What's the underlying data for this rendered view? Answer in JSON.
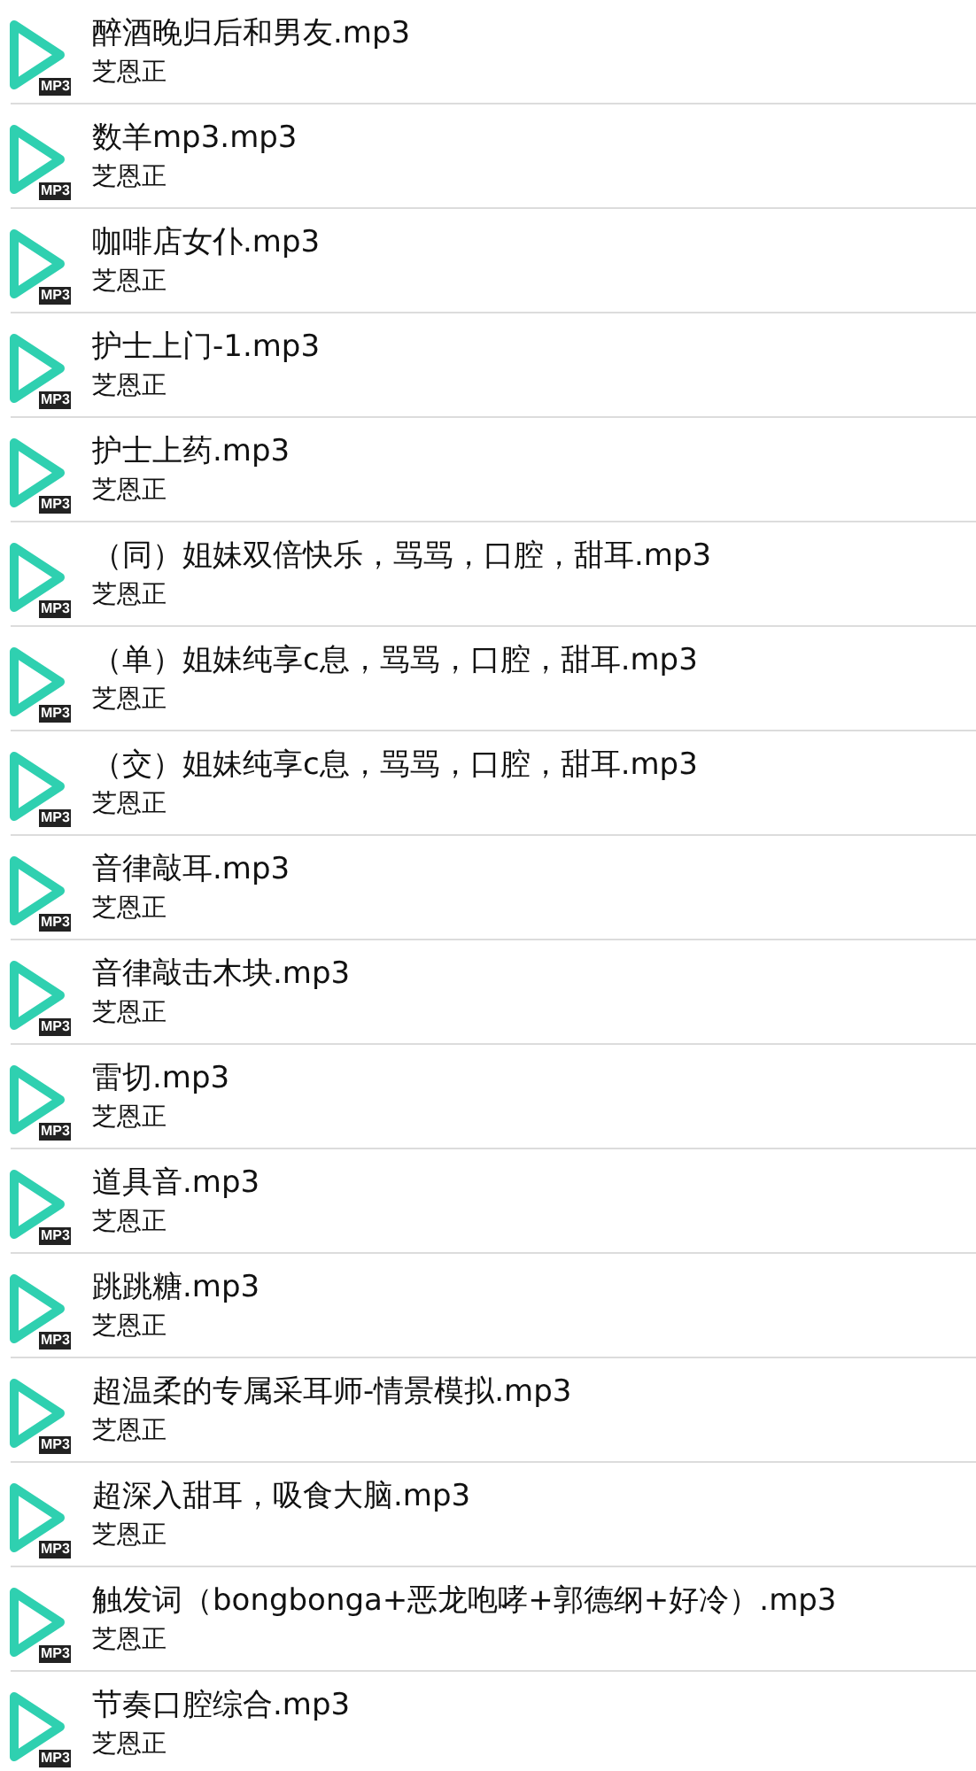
{
  "tracks": [
    {
      "title": "醉酒晚归后和男友.mp3",
      "artist": "芝恩正",
      "badge": "MP3"
    },
    {
      "title": "数羊mp3.mp3",
      "artist": "芝恩正",
      "badge": "MP3"
    },
    {
      "title": "咖啡店女仆.mp3",
      "artist": "芝恩正",
      "badge": "MP3"
    },
    {
      "title": "护士上门-1.mp3",
      "artist": "芝恩正",
      "badge": "MP3"
    },
    {
      "title": "护士上药.mp3",
      "artist": "芝恩正",
      "badge": "MP3"
    },
    {
      "title": "（同）姐妹双倍快乐，骂骂，口腔，甜耳.mp3",
      "artist": "芝恩正",
      "badge": "MP3"
    },
    {
      "title": "（单）姐妹纯享c息，骂骂，口腔，甜耳.mp3",
      "artist": "芝恩正",
      "badge": "MP3"
    },
    {
      "title": "（交）姐妹纯享c息，骂骂，口腔，甜耳.mp3",
      "artist": "芝恩正",
      "badge": "MP3"
    },
    {
      "title": "音律敲耳.mp3",
      "artist": "芝恩正",
      "badge": "MP3"
    },
    {
      "title": "音律敲击木块.mp3",
      "artist": "芝恩正",
      "badge": "MP3"
    },
    {
      "title": "雷切.mp3",
      "artist": "芝恩正",
      "badge": "MP3"
    },
    {
      "title": "道具音.mp3",
      "artist": "芝恩正",
      "badge": "MP3"
    },
    {
      "title": "跳跳糖.mp3",
      "artist": "芝恩正",
      "badge": "MP3"
    },
    {
      "title": "超温柔的专属采耳师-情景模拟.mp3",
      "artist": "芝恩正",
      "badge": "MP3"
    },
    {
      "title": "超深入甜耳，吸食大脑.mp3",
      "artist": "芝恩正",
      "badge": "MP3"
    },
    {
      "title": "触发词（bongbonga+恶龙咆哮+郭德纲+好冷）.mp3",
      "artist": "芝恩正",
      "badge": "MP3"
    },
    {
      "title": "节奏口腔综合.mp3",
      "artist": "芝恩正",
      "badge": "MP3"
    }
  ]
}
